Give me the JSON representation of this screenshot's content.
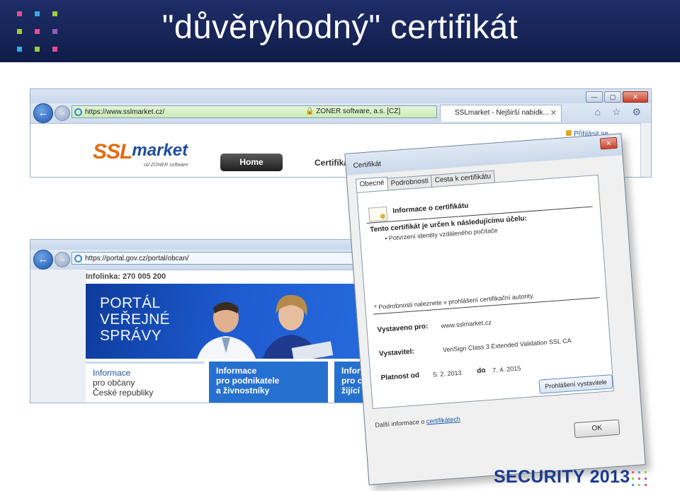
{
  "slide": {
    "title": "\"důvěryhodný\" certifikát",
    "footer": "SECURITY 2013",
    "header_color": "#1d2d66",
    "dot_colors": [
      "#e04f95",
      "#3aa9df",
      "#9ccb3b",
      "#8e5bb8"
    ]
  },
  "browser1": {
    "url": "https://www.sslmarket.cz/",
    "security_label": "ZONER software, a.s. [CZ]",
    "tab_label": "SSLmarket - Nejširší nabídk...",
    "login": "Přihlásit se",
    "logo_ssl": "SSL",
    "logo_market": "market",
    "logo_sub": "od ZONER software",
    "home": "Home",
    "certs": "Certifikáty",
    "nav_back": "←",
    "nav_forward": "→",
    "tab_close": "✕",
    "tools": "⌂ ☆ ⚙",
    "win_min": "—",
    "win_max": "▢",
    "win_close": "✕"
  },
  "browser2": {
    "url": "https://portal.gov.cz/portal/obcan/",
    "infolinka": "Infolinka: 270 005 200",
    "banner_lines": [
      "PORTÁL",
      "VEŘEJNÉ",
      "SPRÁVY"
    ],
    "cards": [
      [
        "Informace",
        "pro občany",
        "České republiky"
      ],
      [
        "Informace",
        "pro podnikatele",
        "a živnostníky"
      ],
      [
        "Informa",
        "pro cizi",
        "žijící v Č"
      ]
    ],
    "nav_back": "←",
    "nav_forward": "→"
  },
  "certificate": {
    "window_title": "Certifikát",
    "close": "✕",
    "tabs": [
      "Obecné",
      "Podrobnosti",
      "Cesta k certifikátu"
    ],
    "info_title": "Informace o certifikátu",
    "purpose_heading": "Tento certifikát je určen k následujícímu účelu:",
    "purpose_item": "• Potvrzení identity vzdáleného počítače",
    "note": "* Podrobnosti naleznete v prohlášení certifikační autority.",
    "issued_to_label": "Vystaveno pro:",
    "issued_to": "www.sslmarket.cz",
    "issuer_label": "Vystavitel:",
    "issuer": "VeriSign Class 3 Extended Validation SSL CA",
    "valid_label": "Platnost od",
    "valid_from": "5. 2. 2013",
    "valid_to_label": "do",
    "valid_to": "7. 4. 2015",
    "statement_button": "Prohlášení vystavitele",
    "more_info_prefix": "Další informace o",
    "more_info_link": "certifikátech",
    "ok": "OK"
  }
}
